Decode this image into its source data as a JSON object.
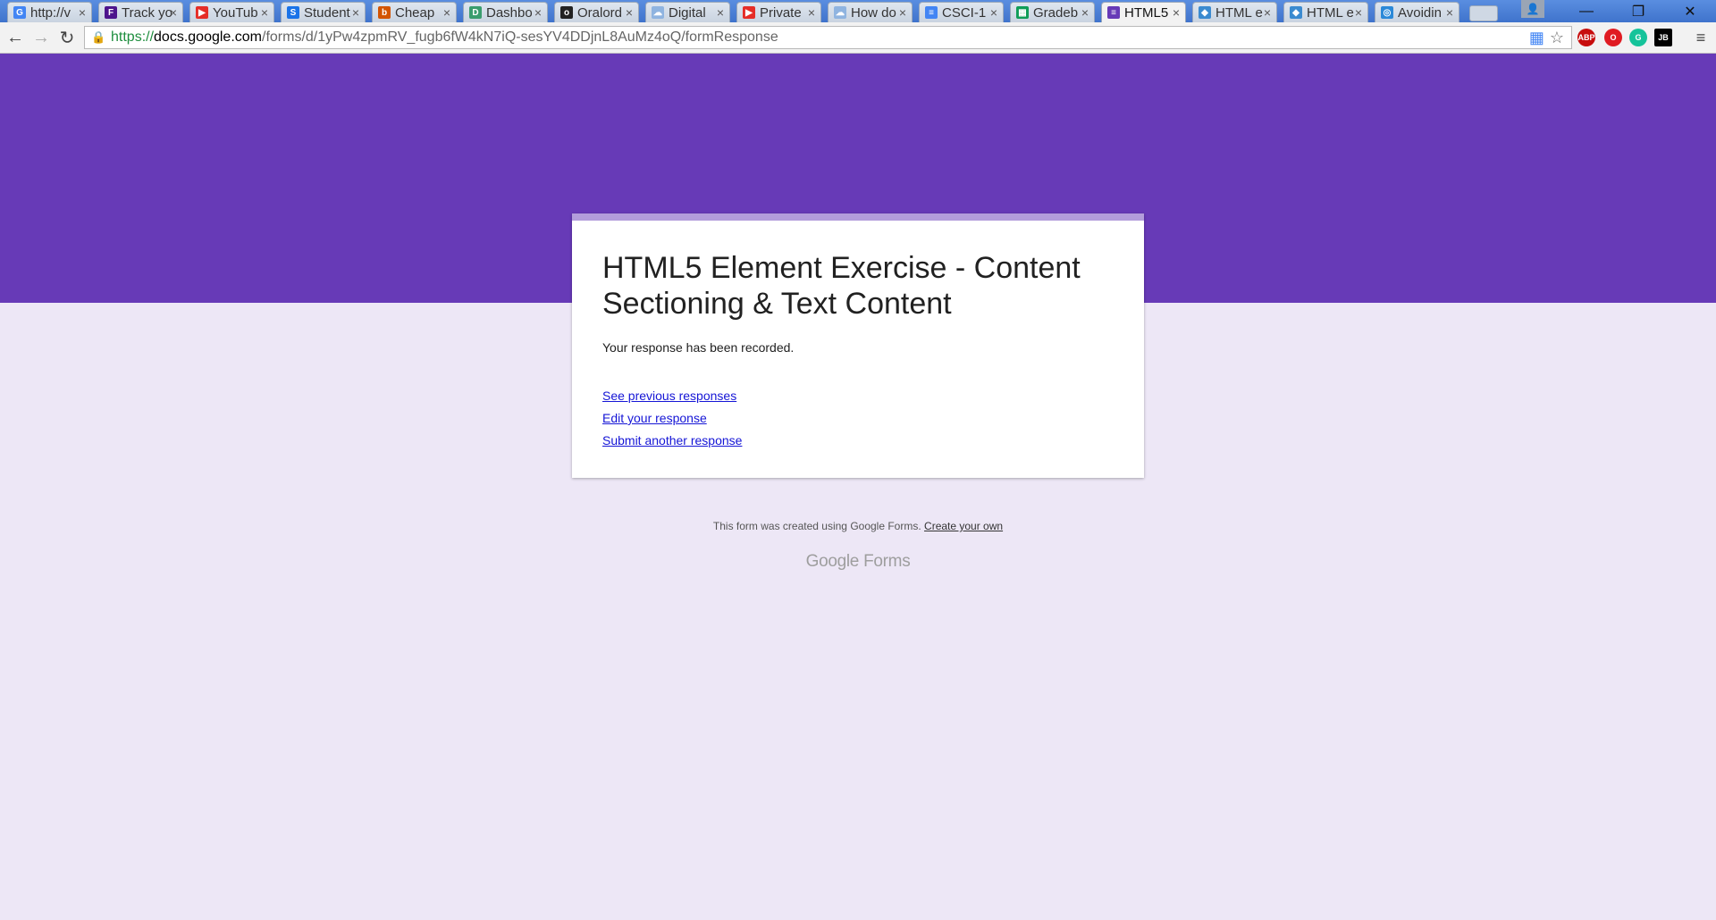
{
  "browser": {
    "tabs": [
      {
        "title": "http://v",
        "favicon_color": "#4285f4",
        "favicon": "G"
      },
      {
        "title": "Track yo",
        "favicon_color": "#4d148c",
        "favicon": "F"
      },
      {
        "title": "YouTub",
        "favicon_color": "#e52d27",
        "favicon": "▶"
      },
      {
        "title": "Student",
        "favicon_color": "#1a73e8",
        "favicon": "S"
      },
      {
        "title": "Cheap",
        "favicon_color": "#d35400",
        "favicon": "b"
      },
      {
        "title": "Dashbo",
        "favicon_color": "#3a9d6e",
        "favicon": "D"
      },
      {
        "title": "Oralord",
        "favicon_color": "#222222",
        "favicon": "o"
      },
      {
        "title": "Digital",
        "favicon_color": "#8fb4e0",
        "favicon": "☁"
      },
      {
        "title": "Private",
        "favicon_color": "#e52d27",
        "favicon": "▶"
      },
      {
        "title": "How do",
        "favicon_color": "#8fb4e0",
        "favicon": "☁"
      },
      {
        "title": "CSCI-1",
        "favicon_color": "#4285f4",
        "favicon": "≡"
      },
      {
        "title": "Gradeb",
        "favicon_color": "#0f9d58",
        "favicon": "▦"
      },
      {
        "title": "HTML5",
        "favicon_color": "#673ab7",
        "favicon": "≡",
        "active": true
      },
      {
        "title": "HTML e",
        "favicon_color": "#3b8bd0",
        "favicon": "◆"
      },
      {
        "title": "HTML e",
        "favicon_color": "#3b8bd0",
        "favicon": "◆"
      },
      {
        "title": "Avoidin",
        "favicon_color": "#2b89d8",
        "favicon": "◎"
      }
    ],
    "tab_close_glyph": "×",
    "address": {
      "protocol": "https://",
      "host": "docs.google.com",
      "path": "/forms/d/1yPw4zpmRV_fugb6fW4kN7iQ-sesYV4DDjnL8AuMz4oQ/formResponse"
    },
    "extensions": [
      {
        "name": "abp",
        "label": "ABP",
        "color": "#c70d0d"
      },
      {
        "name": "opera",
        "label": "O",
        "color": "#e01b22"
      },
      {
        "name": "grammarly",
        "label": "G",
        "color": "#15c39a"
      },
      {
        "name": "jetbrains",
        "label": "JB",
        "color": "#000000"
      }
    ]
  },
  "form": {
    "title": "HTML5 Element Exercise - Content Sectioning & Text Content",
    "message": "Your response has been recorded.",
    "links": {
      "see_previous": "See previous responses",
      "edit": "Edit your response",
      "submit_another": "Submit another response"
    },
    "accent_color": "#673ab7",
    "background_color": "#ede7f6"
  },
  "footer": {
    "note": "This form was created using Google Forms.",
    "create_link": "Create your own",
    "logo_google": "Google",
    "logo_forms": "Forms"
  }
}
